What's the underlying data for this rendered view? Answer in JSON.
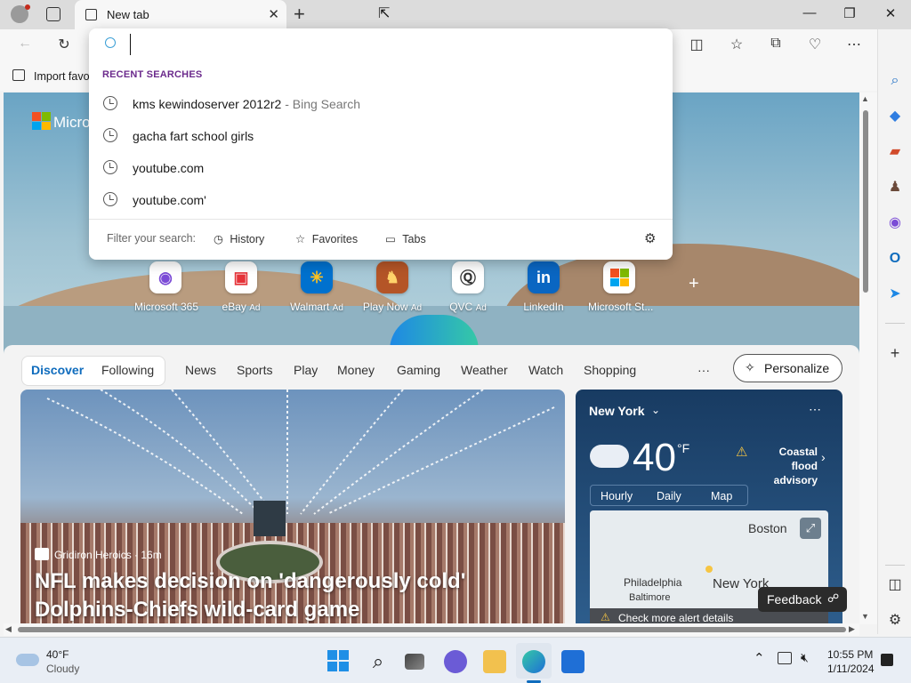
{
  "browser": {
    "tab_title": "New tab",
    "favorites_bar_item": "Import favo",
    "omnibox_value": ""
  },
  "omnibox": {
    "section_title": "RECENT SEARCHES",
    "suggestions": [
      {
        "text": "kms kewindoserver 2012r2",
        "sub": "- Bing Search"
      },
      {
        "text": "gacha fart school girls",
        "sub": ""
      },
      {
        "text": "youtube.com",
        "sub": ""
      },
      {
        "text": "youtube.com'",
        "sub": ""
      }
    ],
    "filter_label": "Filter your search:",
    "filters": [
      "History",
      "Favorites",
      "Tabs"
    ]
  },
  "newtab": {
    "brand": "Micro",
    "quick_links": [
      {
        "label": "Microsoft 365",
        "ad": ""
      },
      {
        "label": "eBay",
        "ad": "Ad"
      },
      {
        "label": "Walmart",
        "ad": "Ad"
      },
      {
        "label": "Play Now",
        "ad": "Ad"
      },
      {
        "label": "QVC",
        "ad": "Ad"
      },
      {
        "label": "LinkedIn",
        "ad": ""
      },
      {
        "label": "Microsoft St...",
        "ad": ""
      }
    ],
    "feed_tabs": [
      "Discover",
      "Following"
    ],
    "categories": [
      "News",
      "Sports",
      "Play",
      "Money",
      "Gaming",
      "Weather",
      "Watch",
      "Shopping"
    ],
    "more": "···",
    "personalize": "Personalize",
    "hero": {
      "source": "Gridiron Heroics · 16m",
      "headline": "NFL makes decision on 'dangerously cold' Dolphins-Chiefs wild-card game"
    },
    "weather": {
      "location": "New York",
      "temp": "40",
      "unit": "°F",
      "alert": "Coastal flood advisory",
      "tabs": [
        "Hourly",
        "Daily",
        "Map"
      ],
      "map_labels": [
        "Boston",
        "Philadelphia",
        "Baltimore",
        "New York"
      ],
      "alert_footer": "Check more alert details"
    },
    "feedback": "Feedback"
  },
  "taskbar": {
    "weather_temp": "40°F",
    "weather_desc": "Cloudy",
    "time": "10:55 PM",
    "date": "1/11/2024"
  },
  "colors": {
    "accent": "#0f6cbd",
    "discover_blue": "#0f6cbd",
    "section_purple": "#6b2a8c"
  }
}
